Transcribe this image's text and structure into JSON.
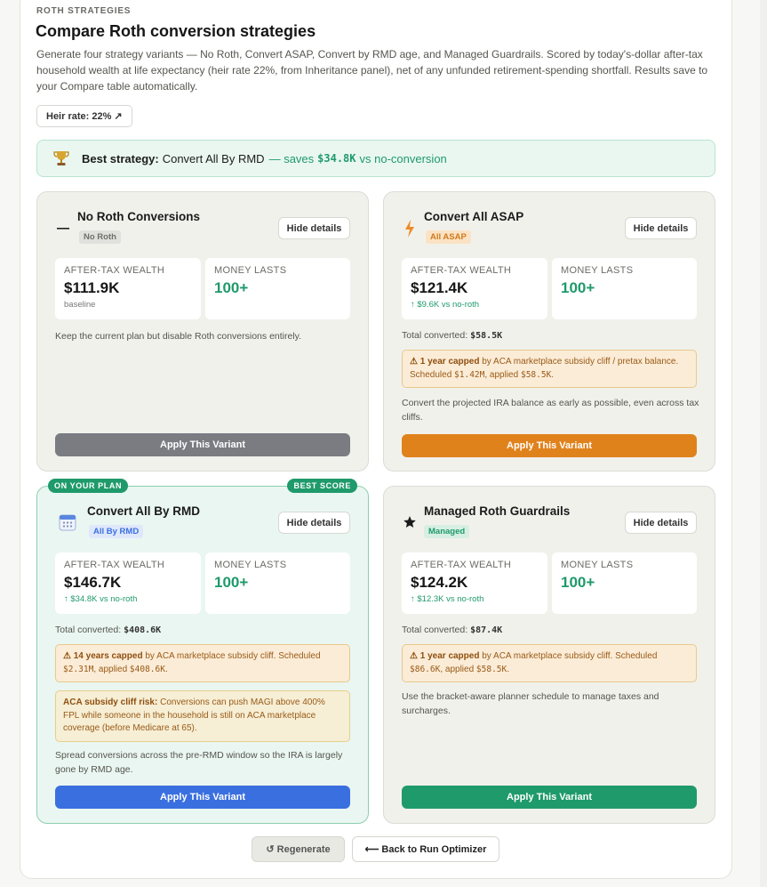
{
  "header": {
    "eyebrow": "ROTH STRATEGIES",
    "title": "Compare Roth conversion strategies",
    "description": "Generate four strategy variants — No Roth, Convert ASAP, Convert by RMD age, and Managed Guardrails. Scored by today's-dollar after-tax household wealth at life expectancy (heir rate 22%, from Inheritance panel), net of any unfunded retirement-spending shortfall. Results save to your Compare table automatically.",
    "heir_rate_label": "Heir rate: 22% ↗"
  },
  "best_banner": {
    "label": "Best strategy:",
    "name": "Convert All By RMD",
    "saves_prefix": "— saves",
    "saves_amount": "$34.8K",
    "saves_suffix": "vs no-conversion"
  },
  "cards": [
    {
      "title": "No Roth Conversions",
      "tag": "No Roth",
      "icon": "dash-icon",
      "hide_label": "Hide details",
      "wealth_label": "AFTER-TAX WEALTH",
      "wealth_value": "$111.9K",
      "wealth_sub": "baseline",
      "money_label": "MONEY LASTS",
      "money_value": "100+",
      "note": "Keep the current plan but disable Roth conversions entirely.",
      "apply_label": "Apply This Variant",
      "apply_color": "#7a7c82"
    },
    {
      "title": "Convert All ASAP",
      "tag": "All ASAP",
      "icon": "lightning-icon",
      "hide_label": "Hide details",
      "wealth_label": "AFTER-TAX WEALTH",
      "wealth_value": "$121.4K",
      "wealth_sub": "↑ $9.6K vs no-roth",
      "money_label": "MONEY LASTS",
      "money_value": "100+",
      "total_label": "Total converted:",
      "total_value": "$58.5K",
      "warn_bold": "⚠ 1 year capped",
      "warn_text": "by ACA marketplace subsidy cliff / pretax balance. Scheduled",
      "warn_sched": "$1.42M",
      "warn_applied_label": ", applied",
      "warn_applied": "$58.5K",
      "note": "Convert the projected IRA balance as early as possible, even across tax cliffs.",
      "apply_label": "Apply This Variant",
      "apply_color": "#e0821c"
    },
    {
      "title": "Convert All By RMD",
      "tag": "All By RMD",
      "icon": "calendar-icon",
      "pill_left": "ON YOUR PLAN",
      "pill_right": "BEST SCORE",
      "hide_label": "Hide details",
      "wealth_label": "AFTER-TAX WEALTH",
      "wealth_value": "$146.7K",
      "wealth_sub": "↑ $34.8K vs no-roth",
      "money_label": "MONEY LASTS",
      "money_value": "100+",
      "total_label": "Total converted:",
      "total_value": "$408.6K",
      "warn_bold": "⚠ 14 years capped",
      "warn_text": "by ACA marketplace subsidy cliff. Scheduled",
      "warn_sched": "$2.31M",
      "warn_applied_label": ", applied",
      "warn_applied": "$408.6K",
      "aca_bold": "ACA subsidy cliff risk:",
      "aca_text": "Conversions can push MAGI above 400% FPL while someone in the household is still on ACA marketplace coverage (before Medicare at 65).",
      "note": "Spread conversions across the pre-RMD window so the IRA is largely gone by RMD age.",
      "apply_label": "Apply This Variant",
      "apply_color": "#3a6fe0"
    },
    {
      "title": "Managed Roth Guardrails",
      "tag": "Managed",
      "icon": "star-icon",
      "hide_label": "Hide details",
      "wealth_label": "AFTER-TAX WEALTH",
      "wealth_value": "$124.2K",
      "wealth_sub": "↑ $12.3K vs no-roth",
      "money_label": "MONEY LASTS",
      "money_value": "100+",
      "total_label": "Total converted:",
      "total_value": "$87.4K",
      "warn_bold": "⚠ 1 year capped",
      "warn_text": "by ACA marketplace subsidy cliff. Scheduled",
      "warn_sched": "$86.6K",
      "warn_applied_label": ", applied",
      "warn_applied": "$58.5K",
      "note": "Use the bracket-aware planner schedule to manage taxes and surcharges.",
      "apply_label": "Apply This Variant",
      "apply_color": "#1f9a6b"
    }
  ],
  "footer": {
    "regenerate_label": "↺ Regenerate",
    "back_label": "⟵ Back to Run Optimizer"
  }
}
